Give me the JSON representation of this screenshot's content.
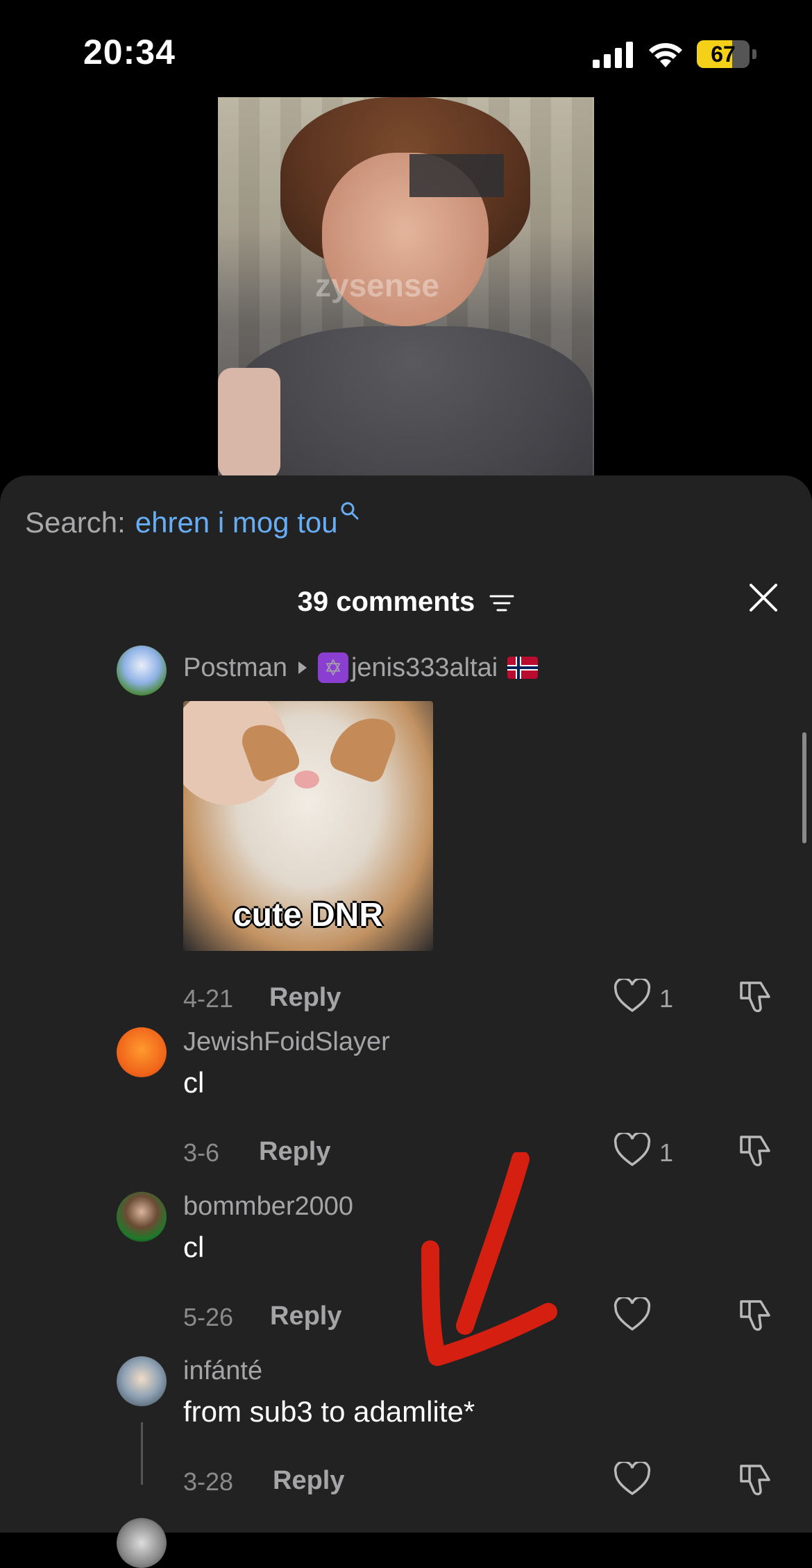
{
  "status": {
    "time": "20:34",
    "battery": "67",
    "battery_level": 0.67
  },
  "video": {
    "watermark": "zysense"
  },
  "search": {
    "label": "Search:",
    "query": "ehren i mog tou"
  },
  "comments_header": {
    "count_label": "39 comments"
  },
  "comments": [
    {
      "username": "Postman",
      "reply_to": "jenis333altai",
      "sticker_caption": "cute DNR",
      "date": "4-21",
      "reply_label": "Reply",
      "likes": "1"
    },
    {
      "username": "JewishFoidSlayer",
      "text": "cl",
      "date": "3-6",
      "reply_label": "Reply",
      "likes": "1"
    },
    {
      "username": "bommber2000",
      "text": "cl",
      "date": "5-26",
      "reply_label": "Reply",
      "likes": ""
    },
    {
      "username": "infánté",
      "text": "from sub3 to adamlite*",
      "date": "3-28",
      "reply_label": "Reply",
      "likes": ""
    }
  ],
  "colors": {
    "accent_link": "#68aef5",
    "sheet_bg": "#222223",
    "annotation_arrow": "#d51f10"
  }
}
